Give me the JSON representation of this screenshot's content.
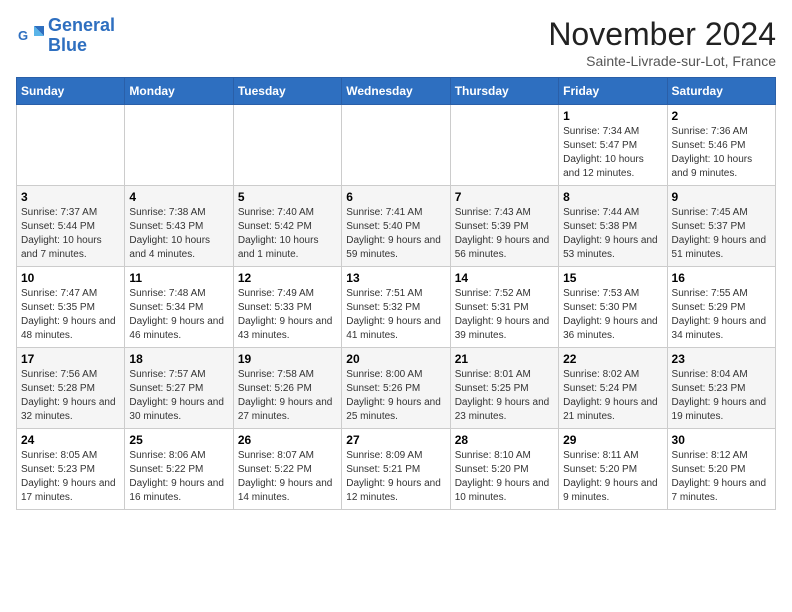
{
  "logo": {
    "line1": "General",
    "line2": "Blue"
  },
  "title": "November 2024",
  "subtitle": "Sainte-Livrade-sur-Lot, France",
  "headers": [
    "Sunday",
    "Monday",
    "Tuesday",
    "Wednesday",
    "Thursday",
    "Friday",
    "Saturday"
  ],
  "weeks": [
    [
      {
        "day": "",
        "info": ""
      },
      {
        "day": "",
        "info": ""
      },
      {
        "day": "",
        "info": ""
      },
      {
        "day": "",
        "info": ""
      },
      {
        "day": "",
        "info": ""
      },
      {
        "day": "1",
        "info": "Sunrise: 7:34 AM\nSunset: 5:47 PM\nDaylight: 10 hours and 12 minutes."
      },
      {
        "day": "2",
        "info": "Sunrise: 7:36 AM\nSunset: 5:46 PM\nDaylight: 10 hours and 9 minutes."
      }
    ],
    [
      {
        "day": "3",
        "info": "Sunrise: 7:37 AM\nSunset: 5:44 PM\nDaylight: 10 hours and 7 minutes."
      },
      {
        "day": "4",
        "info": "Sunrise: 7:38 AM\nSunset: 5:43 PM\nDaylight: 10 hours and 4 minutes."
      },
      {
        "day": "5",
        "info": "Sunrise: 7:40 AM\nSunset: 5:42 PM\nDaylight: 10 hours and 1 minute."
      },
      {
        "day": "6",
        "info": "Sunrise: 7:41 AM\nSunset: 5:40 PM\nDaylight: 9 hours and 59 minutes."
      },
      {
        "day": "7",
        "info": "Sunrise: 7:43 AM\nSunset: 5:39 PM\nDaylight: 9 hours and 56 minutes."
      },
      {
        "day": "8",
        "info": "Sunrise: 7:44 AM\nSunset: 5:38 PM\nDaylight: 9 hours and 53 minutes."
      },
      {
        "day": "9",
        "info": "Sunrise: 7:45 AM\nSunset: 5:37 PM\nDaylight: 9 hours and 51 minutes."
      }
    ],
    [
      {
        "day": "10",
        "info": "Sunrise: 7:47 AM\nSunset: 5:35 PM\nDaylight: 9 hours and 48 minutes."
      },
      {
        "day": "11",
        "info": "Sunrise: 7:48 AM\nSunset: 5:34 PM\nDaylight: 9 hours and 46 minutes."
      },
      {
        "day": "12",
        "info": "Sunrise: 7:49 AM\nSunset: 5:33 PM\nDaylight: 9 hours and 43 minutes."
      },
      {
        "day": "13",
        "info": "Sunrise: 7:51 AM\nSunset: 5:32 PM\nDaylight: 9 hours and 41 minutes."
      },
      {
        "day": "14",
        "info": "Sunrise: 7:52 AM\nSunset: 5:31 PM\nDaylight: 9 hours and 39 minutes."
      },
      {
        "day": "15",
        "info": "Sunrise: 7:53 AM\nSunset: 5:30 PM\nDaylight: 9 hours and 36 minutes."
      },
      {
        "day": "16",
        "info": "Sunrise: 7:55 AM\nSunset: 5:29 PM\nDaylight: 9 hours and 34 minutes."
      }
    ],
    [
      {
        "day": "17",
        "info": "Sunrise: 7:56 AM\nSunset: 5:28 PM\nDaylight: 9 hours and 32 minutes."
      },
      {
        "day": "18",
        "info": "Sunrise: 7:57 AM\nSunset: 5:27 PM\nDaylight: 9 hours and 30 minutes."
      },
      {
        "day": "19",
        "info": "Sunrise: 7:58 AM\nSunset: 5:26 PM\nDaylight: 9 hours and 27 minutes."
      },
      {
        "day": "20",
        "info": "Sunrise: 8:00 AM\nSunset: 5:26 PM\nDaylight: 9 hours and 25 minutes."
      },
      {
        "day": "21",
        "info": "Sunrise: 8:01 AM\nSunset: 5:25 PM\nDaylight: 9 hours and 23 minutes."
      },
      {
        "day": "22",
        "info": "Sunrise: 8:02 AM\nSunset: 5:24 PM\nDaylight: 9 hours and 21 minutes."
      },
      {
        "day": "23",
        "info": "Sunrise: 8:04 AM\nSunset: 5:23 PM\nDaylight: 9 hours and 19 minutes."
      }
    ],
    [
      {
        "day": "24",
        "info": "Sunrise: 8:05 AM\nSunset: 5:23 PM\nDaylight: 9 hours and 17 minutes."
      },
      {
        "day": "25",
        "info": "Sunrise: 8:06 AM\nSunset: 5:22 PM\nDaylight: 9 hours and 16 minutes."
      },
      {
        "day": "26",
        "info": "Sunrise: 8:07 AM\nSunset: 5:22 PM\nDaylight: 9 hours and 14 minutes."
      },
      {
        "day": "27",
        "info": "Sunrise: 8:09 AM\nSunset: 5:21 PM\nDaylight: 9 hours and 12 minutes."
      },
      {
        "day": "28",
        "info": "Sunrise: 8:10 AM\nSunset: 5:20 PM\nDaylight: 9 hours and 10 minutes."
      },
      {
        "day": "29",
        "info": "Sunrise: 8:11 AM\nSunset: 5:20 PM\nDaylight: 9 hours and 9 minutes."
      },
      {
        "day": "30",
        "info": "Sunrise: 8:12 AM\nSunset: 5:20 PM\nDaylight: 9 hours and 7 minutes."
      }
    ]
  ]
}
